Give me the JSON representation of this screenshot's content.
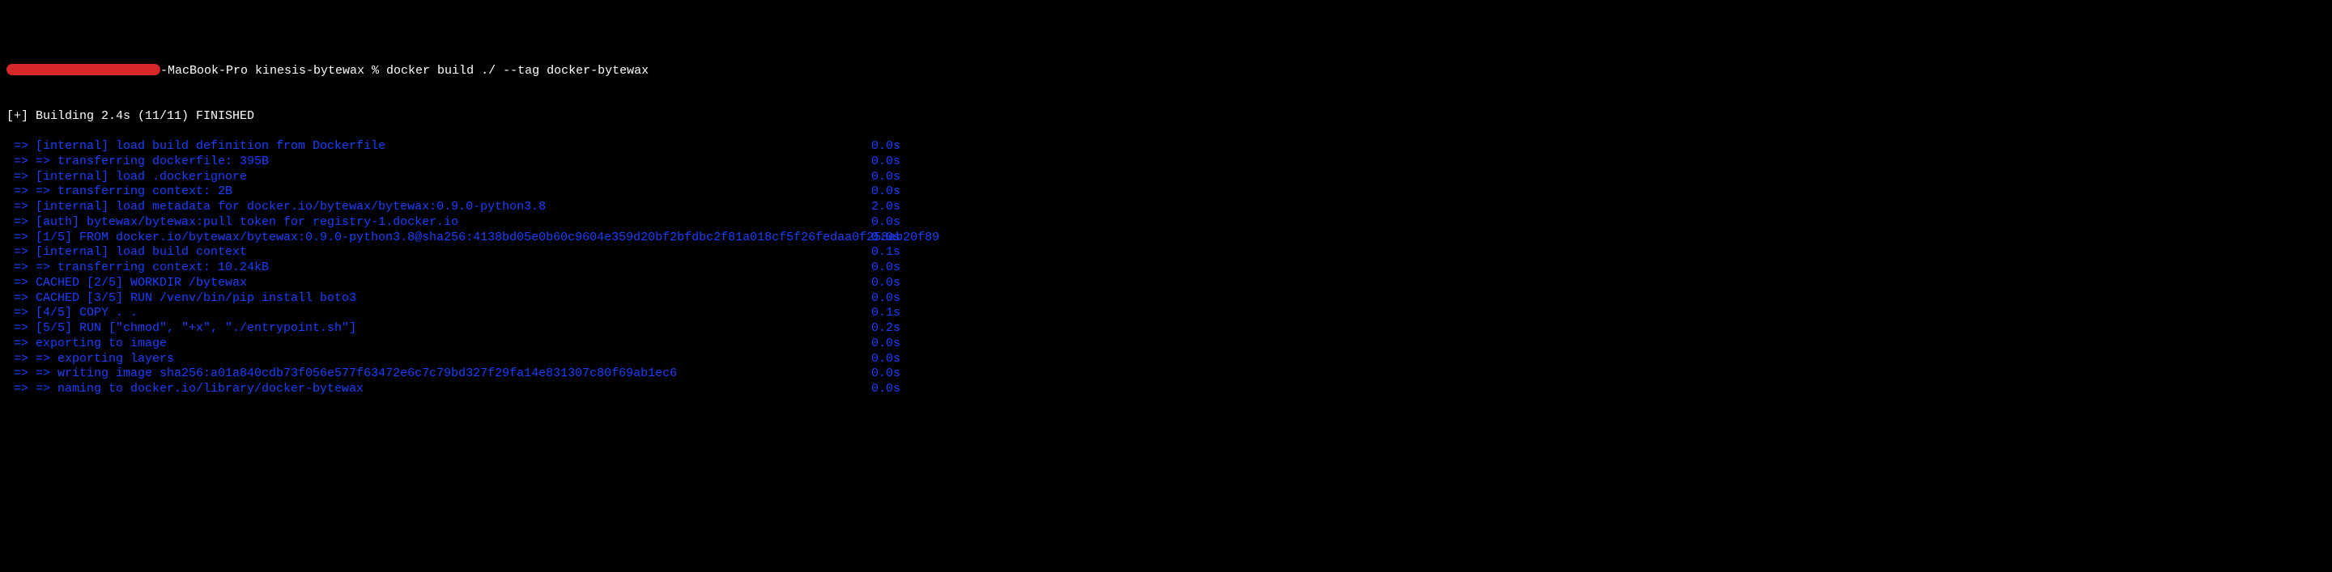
{
  "prompt": {
    "host_suffix": "-MacBook-Pro kinesis-bytewax % ",
    "command": "docker build ./ --tag docker-bytewax"
  },
  "summary": "[+] Building 2.4s (11/11) FINISHED",
  "steps": [
    {
      "arrow": " => ",
      "text": "[internal] load build definition from Dockerfile",
      "time": "0.0s"
    },
    {
      "arrow": " => ",
      "text": "=> transferring dockerfile: 395B",
      "time": "0.0s"
    },
    {
      "arrow": " => ",
      "text": "[internal] load .dockerignore",
      "time": "0.0s"
    },
    {
      "arrow": " => ",
      "text": "=> transferring context: 2B",
      "time": "0.0s"
    },
    {
      "arrow": " => ",
      "text": "[internal] load metadata for docker.io/bytewax/bytewax:0.9.0-python3.8",
      "time": "2.0s"
    },
    {
      "arrow": " => ",
      "text": "[auth] bytewax/bytewax:pull token for registry-1.docker.io",
      "time": "0.0s"
    },
    {
      "arrow": " => ",
      "text": "[1/5] FROM docker.io/bytewax/bytewax:0.9.0-python3.8@sha256:4138bd05e0b60c9604e359d20bf2bfdbc2f81a018cf5f26fedaa0f258ab20f89",
      "time": "0.0s"
    },
    {
      "arrow": " => ",
      "text": "[internal] load build context",
      "time": "0.1s"
    },
    {
      "arrow": " => ",
      "text": "=> transferring context: 10.24kB",
      "time": "0.0s"
    },
    {
      "arrow": " => ",
      "text": "CACHED [2/5] WORKDIR /bytewax",
      "time": "0.0s"
    },
    {
      "arrow": " => ",
      "text": "CACHED [3/5] RUN /venv/bin/pip install boto3",
      "time": "0.0s"
    },
    {
      "arrow": " => ",
      "text": "[4/5] COPY . .",
      "time": "0.1s"
    },
    {
      "arrow": " => ",
      "text": "[5/5] RUN [\"chmod\", \"+x\", \"./entrypoint.sh\"]",
      "time": "0.2s"
    },
    {
      "arrow": " => ",
      "text": "exporting to image",
      "time": "0.0s"
    },
    {
      "arrow": " => ",
      "text": "=> exporting layers",
      "time": "0.0s"
    },
    {
      "arrow": " => ",
      "text": "=> writing image sha256:a01a840cdb73f056e577f63472e6c7c79bd327f29fa14e831307c80f69ab1ec6",
      "time": "0.0s"
    },
    {
      "arrow": " => ",
      "text": "=> naming to docker.io/library/docker-bytewax",
      "time": "0.0s"
    }
  ]
}
